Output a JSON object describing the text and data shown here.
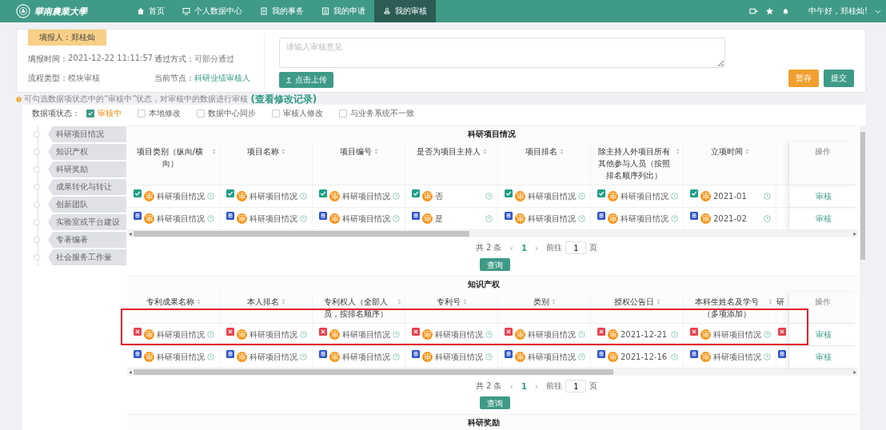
{
  "navbar": {
    "logo": "華南農業大學",
    "items": [
      {
        "label": "首页",
        "selected": false
      },
      {
        "label": "个人数据中心",
        "selected": false
      },
      {
        "label": "我的事务",
        "selected": false
      },
      {
        "label": "我的申请",
        "selected": false
      },
      {
        "label": "我的审核",
        "selected": true
      }
    ],
    "greeting": "中午好，郑桂灿!"
  },
  "review_card": {
    "reporter": "填报人：郑桂灿",
    "fields": [
      {
        "label": "填报时间：",
        "value": "2021-12-22 11:11:57",
        "highlight": false
      },
      {
        "label": "通过方式：",
        "value": "可部分通过",
        "highlight": false
      },
      {
        "label": "流程类型：",
        "value": "模块审核",
        "highlight": false
      },
      {
        "label": "当前节点：",
        "value": "科研业绩审核人",
        "highlight": true
      }
    ],
    "comment_placeholder": "请输入审核意见",
    "upload_button": "点击上传",
    "save_button": "暂存",
    "submit_button": "提交"
  },
  "notice": {
    "text": "可勾选数据项状态中的“审核中”状态，对审核中的数据进行审核",
    "link": "(查看修改记录)"
  },
  "status_filter": {
    "label": "数据项状态：",
    "options": [
      {
        "label": "审核中",
        "checked": true
      },
      {
        "label": "本地修改",
        "checked": false
      },
      {
        "label": "数据中心同步",
        "checked": false
      },
      {
        "label": "审核人修改",
        "checked": false
      },
      {
        "label": "与业务系统不一致",
        "checked": false
      }
    ]
  },
  "outline": [
    "科研项目情况",
    "知识产权",
    "科研奖励",
    "成果转化与转让",
    "创新团队",
    "实验室或平台建设",
    "专著编著",
    "社会服务工作量"
  ],
  "sections": [
    {
      "title": "科研项目情况",
      "columns": [
        {
          "label": "项目类别（纵向/横向）",
          "sortable": true
        },
        {
          "label": "项目名称",
          "sortable": true
        },
        {
          "label": "项目编号",
          "sortable": true
        },
        {
          "label": "是否为项目主持人",
          "sortable": true
        },
        {
          "label": "项目排名",
          "sortable": true
        },
        {
          "label": "除主持人外项目所有其他参与人员（按照排名顺序列出）",
          "sortable": true
        },
        {
          "label": "立项时间",
          "sortable": true
        }
      ],
      "action_header": "操作",
      "rows": [
        {
          "highlighted": false,
          "action": "审核",
          "cells": [
            {
              "kind": "approved",
              "badge": "审",
              "value": "科研项目情况"
            },
            {
              "kind": "approved",
              "badge": "审",
              "value": "科研项目情况"
            },
            {
              "kind": "approved",
              "badge": "审",
              "value": "科研项目情况"
            },
            {
              "kind": "approved",
              "badge": "审",
              "value": "否"
            },
            {
              "kind": "approved",
              "badge": "审",
              "value": "科研项目情况"
            },
            {
              "kind": "approved",
              "badge": "审",
              "value": "科研项目情况"
            },
            {
              "kind": "approved",
              "badge": "审",
              "value": "2021-01"
            }
          ]
        },
        {
          "highlighted": false,
          "action": "审核",
          "cells": [
            {
              "kind": "synced",
              "badge": "审",
              "value": "科研项目情况"
            },
            {
              "kind": "synced",
              "badge": "审",
              "value": "科研项目情况"
            },
            {
              "kind": "synced",
              "badge": "审",
              "value": "科研项目情况"
            },
            {
              "kind": "synced",
              "badge": "审",
              "value": "是"
            },
            {
              "kind": "synced",
              "badge": "审",
              "value": "科研项目情况"
            },
            {
              "kind": "synced",
              "badge": "审",
              "value": "科研项目情况"
            },
            {
              "kind": "synced",
              "badge": "审",
              "value": "2021-02"
            }
          ]
        }
      ],
      "pagination": {
        "total": "共 2 条",
        "prev": "‹",
        "page": "1",
        "next": "›",
        "goto": "前往",
        "page_input": "1",
        "unit": "页"
      },
      "query_button": "查询"
    },
    {
      "title": "知识产权",
      "columns": [
        {
          "label": "专利成果名称",
          "sortable": true
        },
        {
          "label": "本人排名",
          "sortable": true
        },
        {
          "label": "专利权人（全部人员，按排名顺序）",
          "sortable": true
        },
        {
          "label": "专利号",
          "sortable": true
        },
        {
          "label": "类别",
          "sortable": true
        },
        {
          "label": "授权公告日",
          "sortable": true
        },
        {
          "label": "本科生姓名及学号（多项添加）",
          "sortable": true
        },
        {
          "label": "研",
          "sortable": false
        }
      ],
      "action_header": "操作",
      "rows": [
        {
          "highlighted": true,
          "action": "审核",
          "cells": [
            {
              "kind": "rejected",
              "badge": "审",
              "value": "科研项目情况"
            },
            {
              "kind": "rejected",
              "badge": "审",
              "value": "科研项目情况"
            },
            {
              "kind": "rejected",
              "badge": "审",
              "value": "科研项目情况"
            },
            {
              "kind": "rejected",
              "badge": "审",
              "value": "科研项目情况"
            },
            {
              "kind": "rejected",
              "badge": "审",
              "value": "科研项目情况"
            },
            {
              "kind": "rejected",
              "badge": "审",
              "value": "2021-12-21"
            },
            {
              "kind": "rejected",
              "badge": "审",
              "value": "科研项目情况"
            },
            {
              "kind": "rejected"
            }
          ]
        },
        {
          "highlighted": false,
          "action": "审核",
          "cells": [
            {
              "kind": "synced",
              "badge": "审",
              "value": "科研项目情况"
            },
            {
              "kind": "synced",
              "badge": "审",
              "value": "科研项目情况"
            },
            {
              "kind": "synced",
              "badge": "审",
              "value": "科研项目情况"
            },
            {
              "kind": "synced",
              "badge": "审",
              "value": "科研项目情况"
            },
            {
              "kind": "synced",
              "badge": "审",
              "value": "科研项目情况"
            },
            {
              "kind": "synced",
              "badge": "审",
              "value": "2021-12-16"
            },
            {
              "kind": "synced",
              "badge": "审",
              "value": "科研项目情况"
            },
            {
              "kind": "synced"
            }
          ]
        }
      ],
      "pagination": {
        "total": "共 2 条",
        "prev": "‹",
        "page": "1",
        "next": "›",
        "goto": "前往",
        "page_input": "1",
        "unit": "页"
      },
      "query_button": "查询"
    },
    {
      "title": "科研奖励"
    }
  ]
}
